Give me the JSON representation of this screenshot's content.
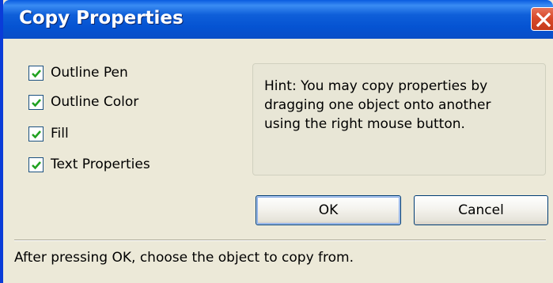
{
  "window": {
    "title": "Copy Properties"
  },
  "options": [
    {
      "label": "Outline Pen",
      "checked": true
    },
    {
      "label": "Outline Color",
      "checked": true
    },
    {
      "label": "Fill",
      "checked": true
    },
    {
      "label": "Text Properties",
      "checked": true
    }
  ],
  "hint": {
    "text": "Hint: You may copy properties by dragging one object onto another using the right mouse button."
  },
  "buttons": {
    "ok_label": "OK",
    "cancel_label": "Cancel"
  },
  "status": {
    "text": "After pressing OK, choose the object to copy from."
  },
  "icons": {
    "close": "close-icon",
    "check": "checkmark-icon"
  },
  "colors": {
    "titlebar": "#0553d2",
    "close_button": "#d94a2a",
    "dialog_background": "#ece9d8",
    "checkmark": "#21a121"
  }
}
